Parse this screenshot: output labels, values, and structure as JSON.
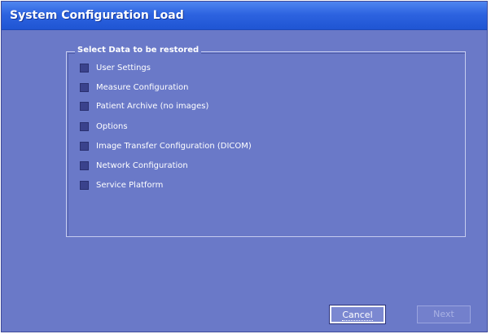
{
  "window": {
    "title": "System Configuration Load"
  },
  "group": {
    "legend": "Select Data to be restored",
    "options": [
      {
        "label": "User Settings",
        "checked": false
      },
      {
        "label": "Measure Configuration",
        "checked": false
      },
      {
        "label": "Patient Archive (no images)",
        "checked": false
      },
      {
        "label": "Options",
        "checked": false
      },
      {
        "label": "Image Transfer Configuration (DICOM)",
        "checked": false
      },
      {
        "label": "Network Configuration",
        "checked": false
      },
      {
        "label": "Service Platform",
        "checked": false
      }
    ]
  },
  "buttons": {
    "cancel_label": "Cancel",
    "next_label": "Next",
    "next_enabled": false
  },
  "colors": {
    "window_background": "#6a79c8",
    "titlebar": "#2d63e0",
    "checkbox_fill": "#3a428c"
  }
}
